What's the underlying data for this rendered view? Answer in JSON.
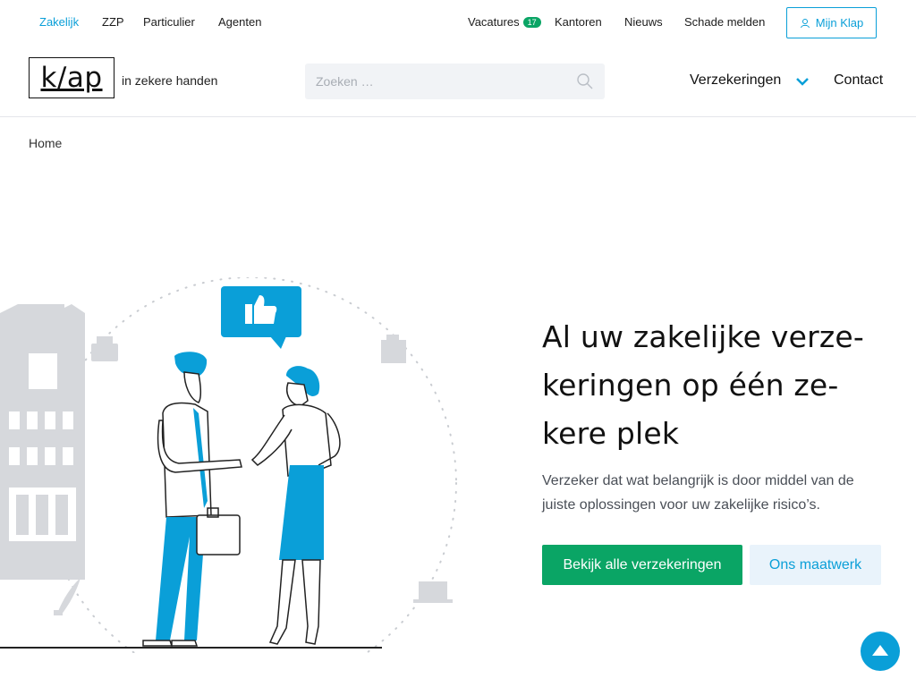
{
  "topnav": {
    "left": [
      "Zakelijk",
      "ZZP",
      "Particulier",
      "Agenten"
    ],
    "vacatures_label": "Vacatures",
    "vacatures_count": "17",
    "right": [
      "Kantoren",
      "Nieuws",
      "Schade melden"
    ],
    "login_label": "Mijn Klap"
  },
  "header": {
    "logo_text": "k/ap",
    "tagline": "in zekere handen",
    "search_placeholder": "Zoeken …",
    "nav_insurance": "Verzekeringen",
    "nav_contact": "Contact"
  },
  "breadcrumb": "Home",
  "hero": {
    "title": "Al uw zakelijke verze-keringen op één ze-kere plek",
    "text": "Verzeker dat wat belangrijk is door middel van de juiste oplossingen voor uw zakelijke risico’s.",
    "primary_button": "Bekijk alle verzekeringen",
    "secondary_button": "Ons maatwerk"
  },
  "colors": {
    "accent_blue": "#0a9fd8",
    "accent_green": "#0aa565"
  },
  "icons": {
    "user": "user-icon",
    "search": "search-icon",
    "chevron": "chevron-down-icon",
    "scroll_top": "arrow-up-icon",
    "thumbs_up": "thumbs-up-icon"
  }
}
